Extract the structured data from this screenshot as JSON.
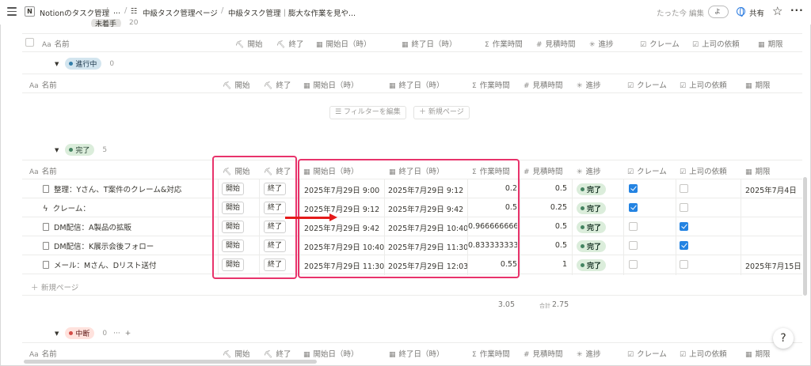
{
  "topbar": {
    "workspace": "Notionのタスク管理",
    "ellipsis": "...",
    "crumb1": "中級タスク管理ページ",
    "crumb2": "中級タスク管理｜膨大な作業を見や...",
    "edited": "たった今 編集",
    "avatar": "よ",
    "share": "共有"
  },
  "columns": {
    "name": "名前",
    "start_btn": "開始",
    "end_btn": "終了",
    "start_date": "開始日（時）",
    "end_date": "終了日（時）",
    "work_time": "作業時間",
    "estimate": "見積時間",
    "progress": "進捗",
    "claim": "クレーム",
    "boss": "上司の依頼",
    "deadline": "期限"
  },
  "groups": {
    "top_partial": {
      "label": "未着手",
      "count": "20"
    },
    "in_progress": {
      "label": "進行中",
      "count": "0"
    },
    "done": {
      "label": "完了",
      "count": "5"
    },
    "paused": {
      "label": "中断",
      "count": "0"
    }
  },
  "filter": {
    "edit": "フィルターを編集",
    "new_page": "新規ページ"
  },
  "rows": [
    {
      "name": "整理：Yさん、T案件のクレーム&対応",
      "icon": "page",
      "start": "2025年7月29日 9:00",
      "end": "2025年7月29日 9:12",
      "work": "0.2",
      "est": "0.5",
      "status": "完了",
      "claim": true,
      "boss": false,
      "deadline": "2025年7月4日"
    },
    {
      "name": "クレーム：",
      "icon": "bolt",
      "start": "2025年7月29日 9:12",
      "end": "2025年7月29日 9:42",
      "work": "0.5",
      "est": "0.25",
      "status": "完了",
      "claim": true,
      "boss": false,
      "deadline": ""
    },
    {
      "name": "DM配信：A製品の拡販",
      "icon": "page",
      "start": "2025年7月29日 9:42",
      "end": "2025年7月29日 10:40",
      "work": "0.9666666666",
      "est": "0.5",
      "status": "完了",
      "claim": false,
      "boss": true,
      "deadline": ""
    },
    {
      "name": "DM配信：K展示会後フォロー",
      "icon": "page",
      "start": "2025年7月29日 10:40",
      "end": "2025年7月29日 11:30",
      "work": "0.8333333333",
      "est": "0.5",
      "status": "完了",
      "claim": false,
      "boss": true,
      "deadline": ""
    },
    {
      "name": "メール：Mさん、Dリスト送付",
      "icon": "page",
      "start": "2025年7月29日 11:30",
      "end": "2025年7月29日 12:03",
      "work": "0.55",
      "est": "1",
      "status": "完了",
      "claim": false,
      "boss": false,
      "deadline": "2025年7月15日"
    }
  ],
  "button_labels": {
    "start": "開始",
    "end": "終了"
  },
  "new_page": "新規ページ",
  "totals": {
    "work": "3.05",
    "est_label": "合計",
    "est": "2.75"
  },
  "help": "?"
}
